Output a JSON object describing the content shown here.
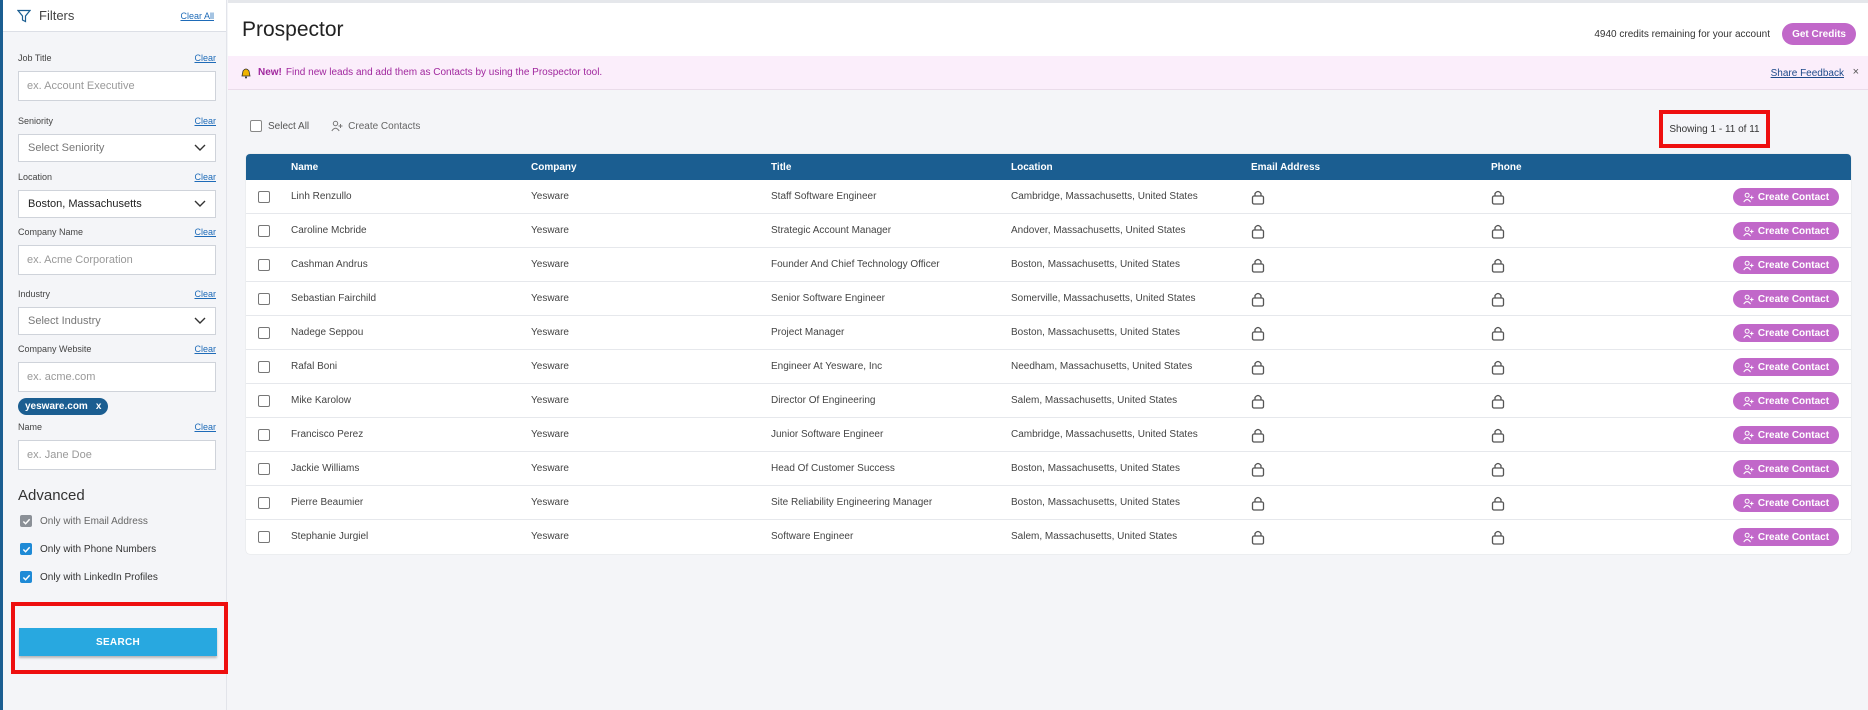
{
  "sidebar": {
    "title": "Filters",
    "clear_all": "Clear All",
    "clear": "Clear",
    "job_title": {
      "label": "Job Title",
      "placeholder": "ex. Account Executive"
    },
    "seniority": {
      "label": "Seniority",
      "value": "Select Seniority"
    },
    "location": {
      "label": "Location",
      "value": "Boston, Massachusetts"
    },
    "company_name": {
      "label": "Company Name",
      "placeholder": "ex. Acme Corporation"
    },
    "industry": {
      "label": "Industry",
      "value": "Select Industry"
    },
    "company_website": {
      "label": "Company Website",
      "placeholder": "ex. acme.com",
      "chip": "yesware.com",
      "chip_remove": "x"
    },
    "name": {
      "label": "Name",
      "placeholder": "ex. Jane Doe"
    },
    "advanced": {
      "title": "Advanced",
      "options": [
        {
          "label": "Only with Email Address",
          "checked": true,
          "state": "disabled"
        },
        {
          "label": "Only with Phone Numbers",
          "checked": true
        },
        {
          "label": "Only with LinkedIn Profiles",
          "checked": true
        }
      ]
    },
    "search_label": "SEARCH"
  },
  "header": {
    "title": "Prospector",
    "credits_text": "4940 credits remaining for your account",
    "get_credits_label": "Get Credits"
  },
  "banner": {
    "new_label": "New!",
    "message": "Find new leads and add them as Contacts by using the Prospector tool.",
    "share_feedback": "Share Feedback",
    "close": "×"
  },
  "toolbar": {
    "select_all": "Select All",
    "create_contacts": "Create Contacts",
    "showing": "Showing 1 - 11 of 11"
  },
  "table": {
    "columns": [
      "Name",
      "Company",
      "Title",
      "Location",
      "Email Address",
      "Phone"
    ],
    "action_label": "Create Contact",
    "rows": [
      {
        "name": "Linh Renzullo",
        "company": "Yesware",
        "title": "Staff Software Engineer",
        "location": "Cambridge, Massachusetts, United States"
      },
      {
        "name": "Caroline Mcbride",
        "company": "Yesware",
        "title": "Strategic Account Manager",
        "location": "Andover, Massachusetts, United States"
      },
      {
        "name": "Cashman Andrus",
        "company": "Yesware",
        "title": "Founder And Chief Technology Officer",
        "location": "Boston, Massachusetts, United States"
      },
      {
        "name": "Sebastian Fairchild",
        "company": "Yesware",
        "title": "Senior Software Engineer",
        "location": "Somerville, Massachusetts, United States"
      },
      {
        "name": "Nadege Seppou",
        "company": "Yesware",
        "title": "Project Manager",
        "location": "Boston, Massachusetts, United States"
      },
      {
        "name": "Rafal Boni",
        "company": "Yesware",
        "title": "Engineer At Yesware, Inc",
        "location": "Needham, Massachusetts, United States"
      },
      {
        "name": "Mike Karolow",
        "company": "Yesware",
        "title": "Director Of Engineering",
        "location": "Salem, Massachusetts, United States"
      },
      {
        "name": "Francisco Perez",
        "company": "Yesware",
        "title": "Junior Software Engineer",
        "location": "Cambridge, Massachusetts, United States"
      },
      {
        "name": "Jackie Williams",
        "company": "Yesware",
        "title": "Head Of Customer Success",
        "location": "Boston, Massachusetts, United States"
      },
      {
        "name": "Pierre Beaumier",
        "company": "Yesware",
        "title": "Site Reliability Engineering Manager",
        "location": "Boston, Massachusetts, United States"
      },
      {
        "name": "Stephanie Jurgiel",
        "company": "Yesware",
        "title": "Software Engineer",
        "location": "Salem, Massachusetts, United States"
      }
    ]
  },
  "colors": {
    "primary_blue": "#1b5e91",
    "accent_purple": "#c168c9",
    "search_blue": "#28a8e0",
    "highlight_red": "#ee0f0f"
  }
}
